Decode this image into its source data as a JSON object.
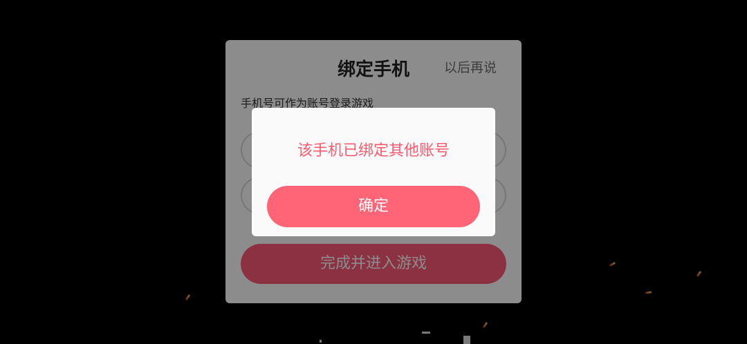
{
  "bind_panel": {
    "title": "绑定手机",
    "later_label": "以后再说",
    "hint": "手机号可作为账号登录游戏",
    "clear_icon": "×",
    "complete_label": "完成并进入游戏"
  },
  "dialog": {
    "message": "该手机已绑定其他账号",
    "confirm_label": "确定"
  },
  "colors": {
    "accent": "#ff6477",
    "message": "#ff5a6e"
  }
}
